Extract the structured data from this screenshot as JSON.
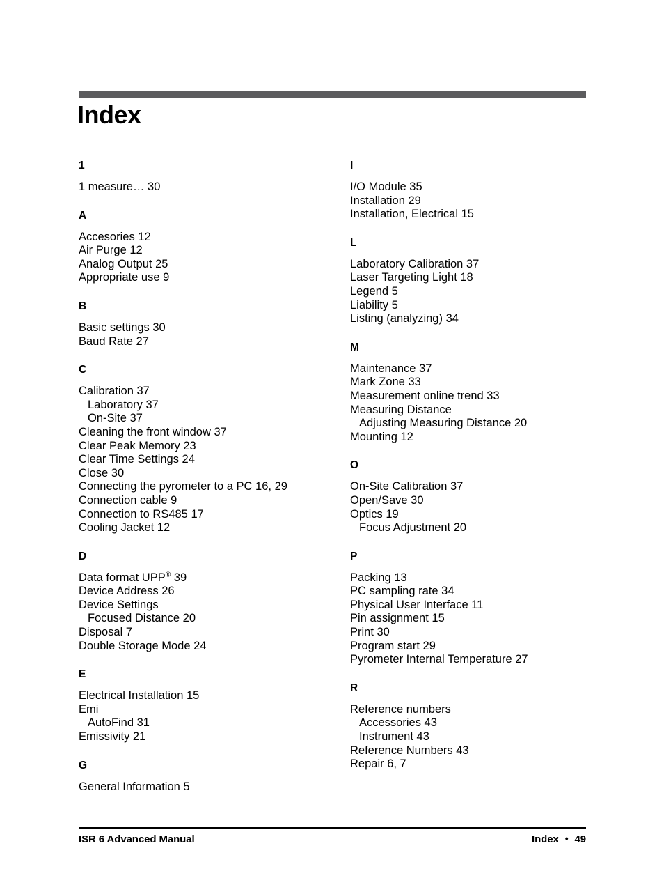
{
  "document": {
    "title": "Index",
    "accent_bar_color": "#5c5c5e"
  },
  "columns": {
    "left": [
      {
        "letter": "1",
        "entries": [
          {
            "text": "1 measure… 30",
            "level": 0
          }
        ]
      },
      {
        "letter": "A",
        "entries": [
          {
            "text": "Accesories 12",
            "level": 0
          },
          {
            "text": "Air Purge 12",
            "level": 0
          },
          {
            "text": "Analog Output 25",
            "level": 0
          },
          {
            "text": "Appropriate use 9",
            "level": 0
          }
        ]
      },
      {
        "letter": "B",
        "entries": [
          {
            "text": "Basic settings 30",
            "level": 0
          },
          {
            "text": "Baud Rate 27",
            "level": 0
          }
        ]
      },
      {
        "letter": "C",
        "entries": [
          {
            "text": "Calibration 37",
            "level": 0
          },
          {
            "text": "Laboratory 37",
            "level": 1
          },
          {
            "text": "On-Site 37",
            "level": 1
          },
          {
            "text": "Cleaning the front window 37",
            "level": 0
          },
          {
            "text": "Clear Peak Memory 23",
            "level": 0
          },
          {
            "text": "Clear Time Settings 24",
            "level": 0
          },
          {
            "text": "Close 30",
            "level": 0
          },
          {
            "text": "Connecting the pyrometer to a PC 16, 29",
            "level": 0
          },
          {
            "text": "Connection cable 9",
            "level": 0
          },
          {
            "text": "Connection to RS485 17",
            "level": 0
          },
          {
            "text": "Cooling Jacket 12",
            "level": 0
          }
        ]
      },
      {
        "letter": "D",
        "entries": [
          {
            "text": "Data format UPP",
            "level": 0,
            "sup": "®",
            "after_sup": " 39"
          },
          {
            "text": "Device Address 26",
            "level": 0
          },
          {
            "text": "Device Settings",
            "level": 0
          },
          {
            "text": "Focused Distance 20",
            "level": 1
          },
          {
            "text": "Disposal 7",
            "level": 0
          },
          {
            "text": "Double Storage Mode 24",
            "level": 0
          }
        ]
      },
      {
        "letter": "E",
        "entries": [
          {
            "text": "Electrical Installation 15",
            "level": 0
          },
          {
            "text": "Emi",
            "level": 0
          },
          {
            "text": "AutoFind 31",
            "level": 1
          },
          {
            "text": "Emissivity 21",
            "level": 0
          }
        ]
      },
      {
        "letter": "G",
        "entries": [
          {
            "text": "General Information 5",
            "level": 0
          }
        ]
      }
    ],
    "right": [
      {
        "letter": "I",
        "entries": [
          {
            "text": "I/O Module 35",
            "level": 0
          },
          {
            "text": "Installation 29",
            "level": 0
          },
          {
            "text": "Installation, Electrical 15",
            "level": 0
          }
        ]
      },
      {
        "letter": "L",
        "entries": [
          {
            "text": "Laboratory Calibration 37",
            "level": 0
          },
          {
            "text": "Laser Targeting Light 18",
            "level": 0
          },
          {
            "text": "Legend 5",
            "level": 0
          },
          {
            "text": "Liability 5",
            "level": 0
          },
          {
            "text": "Listing (analyzing) 34",
            "level": 0
          }
        ]
      },
      {
        "letter": "M",
        "entries": [
          {
            "text": "Maintenance 37",
            "level": 0
          },
          {
            "text": "Mark Zone 33",
            "level": 0
          },
          {
            "text": "Measurement online trend 33",
            "level": 0
          },
          {
            "text": "Measuring Distance",
            "level": 0
          },
          {
            "text": "Adjusting Measuring Distance 20",
            "level": 1
          },
          {
            "text": "Mounting 12",
            "level": 0
          }
        ]
      },
      {
        "letter": "O",
        "entries": [
          {
            "text": "On-Site Calibration 37",
            "level": 0
          },
          {
            "text": "Open/Save 30",
            "level": 0
          },
          {
            "text": "Optics 19",
            "level": 0
          },
          {
            "text": "Focus Adjustment 20",
            "level": 1
          }
        ]
      },
      {
        "letter": "P",
        "entries": [
          {
            "text": "Packing 13",
            "level": 0
          },
          {
            "text": "PC sampling rate 34",
            "level": 0
          },
          {
            "text": "Physical User Interface 11",
            "level": 0
          },
          {
            "text": "Pin assignment 15",
            "level": 0
          },
          {
            "text": "Print 30",
            "level": 0
          },
          {
            "text": "Program start 29",
            "level": 0
          },
          {
            "text": "Pyrometer Internal Temperature 27",
            "level": 0
          }
        ]
      },
      {
        "letter": "R",
        "entries": [
          {
            "text": "Reference numbers",
            "level": 0
          },
          {
            "text": "Accessories 43",
            "level": 1
          },
          {
            "text": "Instrument 43",
            "level": 1
          },
          {
            "text": "Reference Numbers 43",
            "level": 0
          },
          {
            "text": "Repair 6, 7",
            "level": 0
          }
        ]
      }
    ]
  },
  "footer": {
    "left": "ISR 6 Advanced Manual",
    "section": "Index",
    "bullet": "•",
    "page_number": "49"
  }
}
